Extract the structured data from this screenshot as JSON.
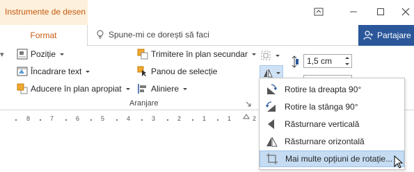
{
  "titlebar": {
    "contextual_label": "Instrumente de desen"
  },
  "tabs": {
    "format_label": "Format",
    "tellme_placeholder": "Spune-mi ce dorești să faci",
    "share_label": "Partajare"
  },
  "ribbon": {
    "pozitie_label": "Poziție",
    "incadrare_label": "Încadrare text",
    "aducere_label": "Aducere în plan apropiat",
    "trimitere_label": "Trimitere în plan secundar",
    "panou_label": "Panou de selecție",
    "aliniere_label": "Aliniere",
    "group_label": "Aranjare",
    "height_value": "1,5 cm"
  },
  "ruler": {
    "numbers": [
      "8",
      "7",
      "6",
      "5",
      "4",
      "3",
      "2",
      "1",
      "1",
      "2"
    ]
  },
  "rotate_menu": {
    "items": [
      {
        "label": "Rotire la dreapta 90°",
        "icon": "rotate-right-icon"
      },
      {
        "label": "Rotire la stânga 90°",
        "icon": "rotate-left-icon"
      },
      {
        "label": "Răsturnare verticală",
        "icon": "flip-vertical-icon"
      },
      {
        "label": "Răsturnare orizontală",
        "icon": "flip-horizontal-icon"
      },
      {
        "label": "Mai multe opțiuni de rotație...",
        "icon": "more-rotation-options-icon"
      }
    ],
    "highlighted_index": 4
  },
  "colors": {
    "contextual_accent": "#c55a11",
    "share_bg": "#2b579a",
    "menu_highlight": "#c5dcf2"
  }
}
